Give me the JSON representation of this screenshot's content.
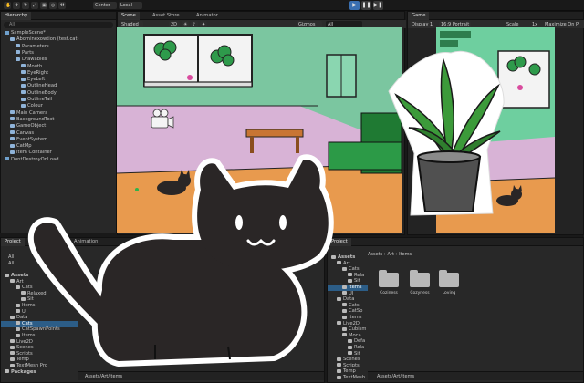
{
  "toolbar": {
    "pivot_center": "Center",
    "pivot_local": "Local",
    "play_icon": "play-icon",
    "pause_icon": "pause-icon",
    "step_icon": "step-icon"
  },
  "hierarchy": {
    "tab": "Hierarchy",
    "search_placeholder": "All",
    "scene_name": "SampleScene*",
    "items": [
      {
        "label": "SampleScene*",
        "indent": 0,
        "type": "scene"
      },
      {
        "label": "Abominexowtion (test.cat)",
        "indent": 1,
        "type": "go"
      },
      {
        "label": "Parameters",
        "indent": 2,
        "type": "go"
      },
      {
        "label": "Parts",
        "indent": 2,
        "type": "go"
      },
      {
        "label": "Drawables",
        "indent": 2,
        "type": "go"
      },
      {
        "label": "Mouth",
        "indent": 3,
        "type": "go"
      },
      {
        "label": "EyeRight",
        "indent": 3,
        "type": "go"
      },
      {
        "label": "EyeLeft",
        "indent": 3,
        "type": "go"
      },
      {
        "label": "OutlineHead",
        "indent": 3,
        "type": "go"
      },
      {
        "label": "OutlineBody",
        "indent": 3,
        "type": "go"
      },
      {
        "label": "OutlineTail",
        "indent": 3,
        "type": "go"
      },
      {
        "label": "Colour",
        "indent": 3,
        "type": "go"
      },
      {
        "label": "Main Camera",
        "indent": 1,
        "type": "go"
      },
      {
        "label": "BackgroundText",
        "indent": 1,
        "type": "go"
      },
      {
        "label": "GameObject",
        "indent": 1,
        "type": "go"
      },
      {
        "label": "Canvas",
        "indent": 1,
        "type": "go"
      },
      {
        "label": "EventSystem",
        "indent": 1,
        "type": "go"
      },
      {
        "label": "CatMp",
        "indent": 1,
        "type": "go"
      },
      {
        "label": "Item Container",
        "indent": 1,
        "type": "go"
      },
      {
        "label": "DontDestroyOnLoad",
        "indent": 0,
        "type": "scene"
      }
    ]
  },
  "scene": {
    "tabs": [
      "Scene",
      "Asset Store",
      "Animator"
    ],
    "shading": "Shaded",
    "mode_2d": "2D",
    "gizmos": "Gizmos",
    "search_placeholder": "All"
  },
  "game": {
    "tab": "Game",
    "display": "Display 1",
    "aspect": "16:9 Portrait",
    "scale_label": "Scale",
    "scale_value": "1x",
    "maximize": "Maximize On Pl"
  },
  "project_left": {
    "tabs": [
      "Project",
      "Animation"
    ],
    "favorites": [
      "All",
      "All"
    ],
    "tree": [
      {
        "label": "Assets",
        "indent": 0,
        "bold": true
      },
      {
        "label": "Art",
        "indent": 1
      },
      {
        "label": "Cats",
        "indent": 2
      },
      {
        "label": "Relaxed",
        "indent": 3
      },
      {
        "label": "Sit",
        "indent": 3
      },
      {
        "label": "Items",
        "indent": 2
      },
      {
        "label": "UI",
        "indent": 2
      },
      {
        "label": "Data",
        "indent": 1
      },
      {
        "label": "Cats",
        "indent": 2,
        "selected": true
      },
      {
        "label": "CatSpawnPoints",
        "indent": 2
      },
      {
        "label": "Items",
        "indent": 2
      },
      {
        "label": "Live2D",
        "indent": 1
      },
      {
        "label": "Scenes",
        "indent": 1
      },
      {
        "label": "Scripts",
        "indent": 1
      },
      {
        "label": "Temp",
        "indent": 1
      },
      {
        "label": "TextMesh Pro",
        "indent": 1
      },
      {
        "label": "Packages",
        "indent": 0,
        "bold": true
      }
    ],
    "path": "Assets/Art/Items"
  },
  "project_right": {
    "tab": "Project",
    "breadcrumb": [
      "Assets",
      "Art",
      "Items"
    ],
    "tree": [
      {
        "label": "Assets",
        "indent": 0,
        "bold": true
      },
      {
        "label": "Art",
        "indent": 1
      },
      {
        "label": "Cats",
        "indent": 2
      },
      {
        "label": "Rela",
        "indent": 3
      },
      {
        "label": "Sit",
        "indent": 3
      },
      {
        "label": "Items",
        "indent": 2,
        "selected": true
      },
      {
        "label": "UI",
        "indent": 2
      },
      {
        "label": "Data",
        "indent": 1
      },
      {
        "label": "Cats",
        "indent": 2
      },
      {
        "label": "CatSp",
        "indent": 2
      },
      {
        "label": "Items",
        "indent": 2
      },
      {
        "label": "Live2D",
        "indent": 1
      },
      {
        "label": "Cubism",
        "indent": 2
      },
      {
        "label": "Moca",
        "indent": 2
      },
      {
        "label": "Defa",
        "indent": 3
      },
      {
        "label": "Rela",
        "indent": 3
      },
      {
        "label": "Sit",
        "indent": 3
      },
      {
        "label": "Scenes",
        "indent": 1
      },
      {
        "label": "Scripts",
        "indent": 1
      },
      {
        "label": "Temp",
        "indent": 1
      },
      {
        "label": "TextMesh",
        "indent": 1
      }
    ],
    "folders": [
      "Coziness",
      "Cozyness",
      "Loving"
    ],
    "path": "Assets/Art/Items"
  },
  "colors": {
    "scene_wall": "#7bc6a0",
    "game_wall": "#6ecf9f",
    "pink_wall": "#d8b3d6",
    "floor": "#e89a4e",
    "sofa": "#1f7a33",
    "cat": "#2a2626",
    "selection": "#2c5d87"
  }
}
